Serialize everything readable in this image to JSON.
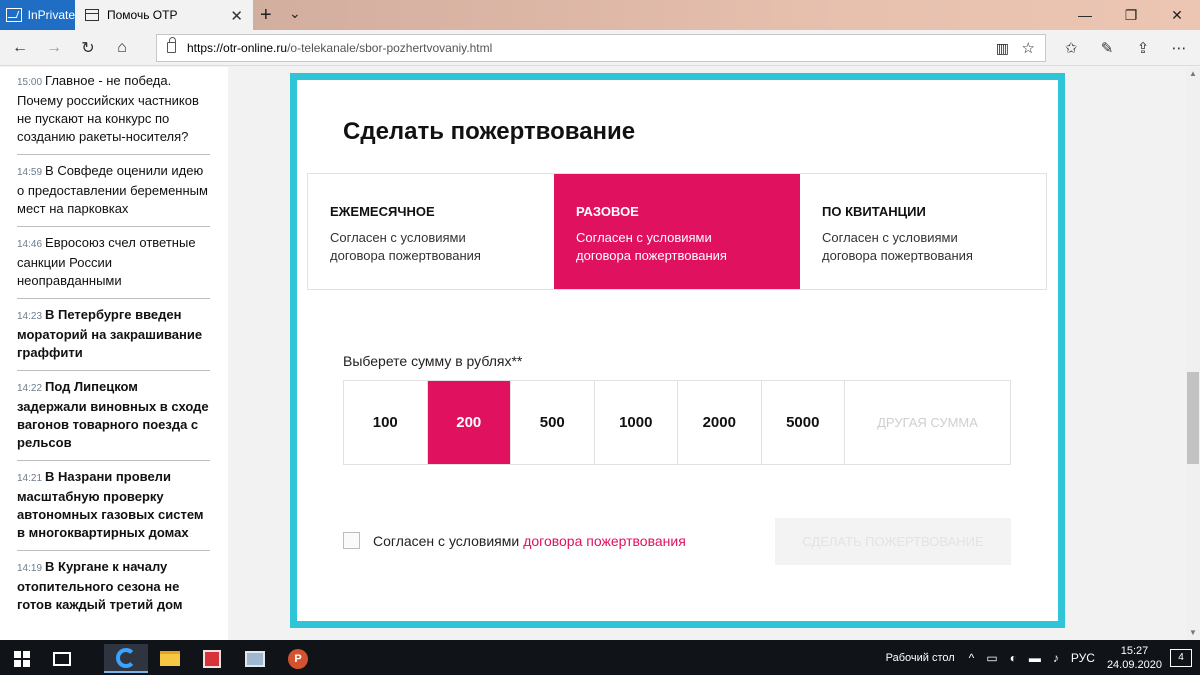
{
  "browser": {
    "inprivate_label": "InPrivate",
    "tab_title": "Помочь ОТР",
    "tab_close": "✕",
    "new_tab": "+",
    "tab_menu": "⌄",
    "win_minimize": "—",
    "win_maximize": "❐",
    "win_close": "✕",
    "back": "←",
    "forward": "→",
    "refresh": "↻",
    "home": "⌂",
    "url_host": "https://otr-online.ru",
    "url_path": "/o-telekanale/sbor-pozhertvovaniy.html",
    "reader": "▥",
    "favorite": "☆",
    "tools": [
      "✩",
      "✎",
      "⇪",
      "⋯"
    ]
  },
  "news": [
    {
      "time": "15:00",
      "text": "Главное - не победа. Почему российских частников не пускают на конкурс по созданию ракеты-носителя?",
      "bold": false
    },
    {
      "time": "14:59",
      "text": "В Совфеде оценили идею о предоставлении беременным мест на парковках",
      "bold": false
    },
    {
      "time": "14:46",
      "text": "Евросоюз счел ответные санкции России неоправданными",
      "bold": false
    },
    {
      "time": "14:23",
      "text": "В Петербурге введен мораторий на закрашивание граффити",
      "bold": true
    },
    {
      "time": "14:22",
      "text": "Под Липецком задержали виновных в сходе вагонов товарного поезда с рельсов",
      "bold": true
    },
    {
      "time": "14:21",
      "text": "В Назрани провели масштабную проверку автономных газовых систем в многоквартирных домах",
      "bold": true
    },
    {
      "time": "14:19",
      "text": "В Кургане к началу отопительного сезона не готов каждый третий дом",
      "bold": true
    }
  ],
  "donation": {
    "title": "Сделать пожертвование",
    "types": [
      {
        "title": "Ежемесячное",
        "desc": "Согласен с условиями договора пожертвования",
        "active": false
      },
      {
        "title": "Разовое",
        "desc": "Согласен с условиями договора пожертвования",
        "active": true
      },
      {
        "title": "По квитанции",
        "desc": "Согласен с условиями договора пожертвования",
        "active": false
      }
    ],
    "amount_label": "Выберете сумму в рублях**",
    "amounts": [
      "100",
      "200",
      "500",
      "1000",
      "2000",
      "5000"
    ],
    "selected_amount": "200",
    "other_amount": "Другая сумма",
    "agree_text": "Согласен с условиями",
    "agree_link": "договора пожертвования",
    "agree_checked": false,
    "submit": "Сделать пожертвование",
    "accent_color": "#e0115f",
    "frame_color": "#2fc5d6"
  },
  "taskbar": {
    "desktop_label": "Рабочий стол",
    "lang": "РУС",
    "time": "15:27",
    "date": "24.09.2020",
    "notifications": "4",
    "tray_icons": [
      "^",
      "▭",
      "◐",
      "▬",
      "♪"
    ],
    "apps": [
      "windows-start",
      "task-view",
      "edge",
      "file-explorer",
      "gift-app",
      "remote-desktop",
      "powerpoint"
    ]
  }
}
